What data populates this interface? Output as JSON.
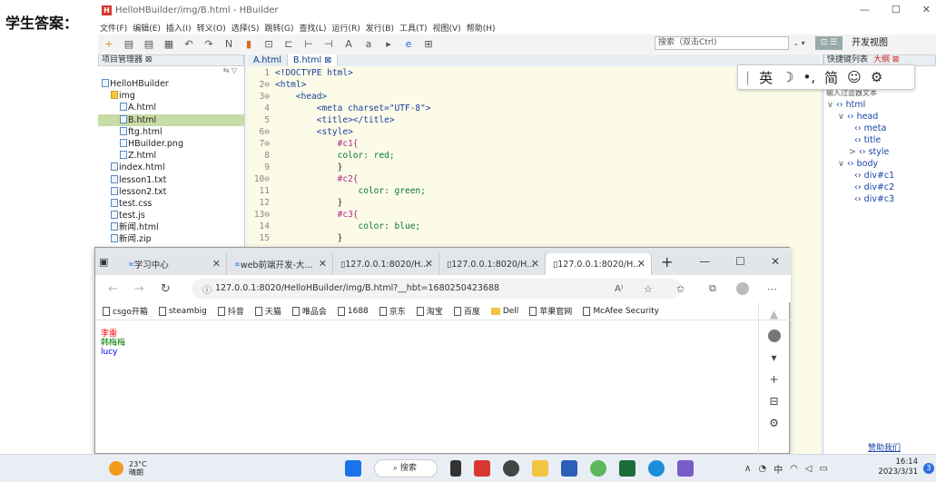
{
  "prefix_label": "学生答案：",
  "hbuilder": {
    "title": "HelloHBuilder/img/B.html - HBuilder",
    "window_controls": [
      "—",
      "☐",
      "✕"
    ],
    "menu": [
      "文件(F)",
      "编辑(E)",
      "插入(I)",
      "转义(O)",
      "选择(S)",
      "跳转(G)",
      "查找(L)",
      "运行(R)",
      "发行(B)",
      "工具(T)",
      "视图(V)",
      "帮助(H)"
    ],
    "search_placeholder": "搜索（双击Ctrl)",
    "dev_view_label": "开发视图",
    "explorer": {
      "title": "项目管理器 ⊠",
      "items": [
        {
          "label": "HelloHBuilder",
          "indent": 0,
          "icon": "project-icon"
        },
        {
          "label": "img",
          "indent": 1,
          "icon": "folder-icon"
        },
        {
          "label": "A.html",
          "indent": 2,
          "icon": "html-file-icon"
        },
        {
          "label": "B.html",
          "indent": 2,
          "icon": "html-file-icon",
          "selected": true
        },
        {
          "label": "ftg.html",
          "indent": 2,
          "icon": "html-file-icon"
        },
        {
          "label": "HBuilder.png",
          "indent": 2,
          "icon": "image-file-icon"
        },
        {
          "label": "Z.html",
          "indent": 2,
          "icon": "html-file-icon"
        },
        {
          "label": "index.html",
          "indent": 1,
          "icon": "html-file-icon"
        },
        {
          "label": "lesson1.txt",
          "indent": 1,
          "icon": "text-file-icon"
        },
        {
          "label": "lesson2.txt",
          "indent": 1,
          "icon": "text-file-icon"
        },
        {
          "label": "test.css",
          "indent": 1,
          "icon": "css-file-icon"
        },
        {
          "label": "test.js",
          "indent": 1,
          "icon": "js-file-icon"
        },
        {
          "label": "新闻.html",
          "indent": 1,
          "icon": "html-file-icon"
        },
        {
          "label": "新闻.zip",
          "indent": 1,
          "icon": "zip-file-icon"
        }
      ]
    },
    "editor_tabs": [
      "A.html",
      "B.html ⊠"
    ],
    "code_lines": [
      {
        "n": "1",
        "text": "<!DOCTYPE html>"
      },
      {
        "n": "2⊖",
        "text": "<html>"
      },
      {
        "n": "3⊖",
        "text": "    <head>"
      },
      {
        "n": "4",
        "text": "        <meta charset=\"UTF-8\">"
      },
      {
        "n": "5",
        "text": "        <title></title>"
      },
      {
        "n": "6⊖",
        "text": "        <style>"
      },
      {
        "n": "7⊖",
        "text": "            #c1{"
      },
      {
        "n": "8",
        "text": "            color: red;"
      },
      {
        "n": "9",
        "text": "            }"
      },
      {
        "n": "10⊖",
        "text": "            #c2{"
      },
      {
        "n": "11",
        "text": "                color: green;"
      },
      {
        "n": "12",
        "text": "            }"
      },
      {
        "n": "13⊖",
        "text": "            #c3{"
      },
      {
        "n": "14",
        "text": "                color: blue;"
      },
      {
        "n": "15",
        "text": "            }"
      }
    ],
    "outline_tabs": [
      "快捷键列表",
      "大纲 ⊠"
    ],
    "outline_filter_placeholder": "输入过滤器文本",
    "outline": [
      {
        "label": "html",
        "indent": 0,
        "arrow": "∨"
      },
      {
        "label": "head",
        "indent": 1,
        "arrow": "∨"
      },
      {
        "label": "meta",
        "indent": 2,
        "arrow": ""
      },
      {
        "label": "title",
        "indent": 2,
        "arrow": ""
      },
      {
        "label": "style",
        "indent": 2,
        "arrow": ">"
      },
      {
        "label": "body",
        "indent": 1,
        "arrow": "∨"
      },
      {
        "label": "div#c1",
        "indent": 2,
        "arrow": ""
      },
      {
        "label": "div#c2",
        "indent": 2,
        "arrow": ""
      },
      {
        "label": "div#c3",
        "indent": 2,
        "arrow": ""
      }
    ],
    "help_link": "赞助我们"
  },
  "ime": {
    "items": [
      "英",
      "☽",
      "•,",
      "简",
      "☺",
      "⚙"
    ]
  },
  "browser": {
    "tabs": [
      {
        "label": "学习中心",
        "icon": "edge-logo-icon"
      },
      {
        "label": "web前端开发-大...",
        "icon": "edge-logo-icon"
      },
      {
        "label": "127.0.0.1:8020/H...",
        "icon": "page-icon"
      },
      {
        "label": "127.0.0.1:8020/H...",
        "icon": "page-icon"
      },
      {
        "label": "127.0.0.1:8020/H...",
        "icon": "page-icon",
        "active": true
      }
    ],
    "url": "127.0.0.1:8020/HelloHBuilder/img/B.html?__hbt=1680250423688",
    "favorites": [
      "csgo开箱",
      "steambig",
      "抖音",
      "天猫",
      "唯品会",
      "1688",
      "京东",
      "淘宝",
      "百度",
      "Dell",
      "苹果官网",
      "McAfee Security"
    ],
    "content": [
      {
        "text": "李雷",
        "color": "#ff0000"
      },
      {
        "text": "韩梅梅",
        "color": "#008000"
      },
      {
        "text": "lucy",
        "color": "#0000ff"
      }
    ]
  },
  "taskbar": {
    "temp": "23°C",
    "weather": "晴朗",
    "search_label": "搜索",
    "tray_lang": "中",
    "time": "16:14",
    "date": "2023/3/31",
    "notif_count": "3"
  }
}
